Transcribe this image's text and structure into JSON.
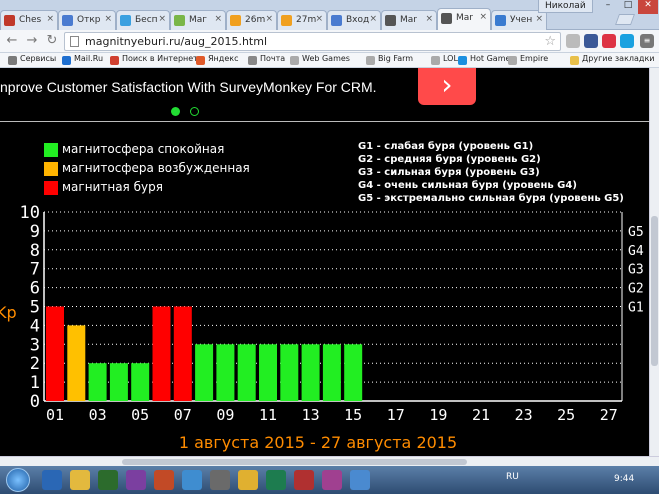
{
  "browser": {
    "tabs": [
      {
        "label": "Ches",
        "color": "#c0392b"
      },
      {
        "label": "Откр",
        "color": "#4a7bd0"
      },
      {
        "label": "Бесп",
        "color": "#3aa0e0"
      },
      {
        "label": "Maг",
        "color": "#7ab648"
      },
      {
        "label": "26m",
        "color": "#f0a020"
      },
      {
        "label": "27m",
        "color": "#f0a020"
      },
      {
        "label": "Вход",
        "color": "#4a7bd0"
      },
      {
        "label": "Mar",
        "color": "#555555"
      },
      {
        "label": "Mar",
        "color": "#555555"
      },
      {
        "label": "Учен",
        "color": "#3a7bd0"
      }
    ],
    "user_label": "Николай",
    "url": "magnitnyeburi.ru/aug_2015.html",
    "bookmarks": [
      {
        "label": "Сервисы",
        "color": "#7a7a7a"
      },
      {
        "label": "Mail.Ru",
        "color": "#1e6fd0"
      },
      {
        "label": "Поиск в Интернете",
        "color": "#d04030"
      },
      {
        "label": "Яндекс",
        "color": "#e05a2a"
      },
      {
        "label": "Почта",
        "color": "#888888"
      },
      {
        "label": "Web Games",
        "color": "#aaaaaa"
      },
      {
        "label": "Big Farm",
        "color": "#aaaaaa"
      },
      {
        "label": "LOL",
        "color": "#aaaaaa"
      },
      {
        "label": "Hot Game",
        "color": "#1a8fe0"
      },
      {
        "label": "Empire",
        "color": "#aaaaaa"
      },
      {
        "label": "Другие закладки",
        "color": "#e8c04a"
      }
    ]
  },
  "ad": {
    "text": "nprove Customer Satisfaction With SurveyMonkey For CRM.",
    "arrow": "›"
  },
  "legend": [
    {
      "label": "магнитосфера спокойная",
      "color": "#22ee22"
    },
    {
      "label": "магнитосфера возбужденная",
      "color": "#ffb400"
    },
    {
      "label": "магнитная буря",
      "color": "#ff0000"
    }
  ],
  "g_levels": [
    "G1 - слабая буря (уровень G1)",
    "G2 - средняя буря (уровень G2)",
    "G3 - сильная буря (уровень G3)",
    "G4 - очень сильная буря (уровень G4)",
    "G5 - экстремально сильная буря (уровень G5)"
  ],
  "chart_data": {
    "type": "bar",
    "ylabel": "Kp",
    "ylim": [
      0,
      10
    ],
    "y_ticks": [
      "0",
      "1",
      "2",
      "3",
      "4",
      "5",
      "6",
      "7",
      "8",
      "9",
      "10"
    ],
    "right_labels": [
      {
        "y": 5,
        "label": "G1"
      },
      {
        "y": 6,
        "label": "G2"
      },
      {
        "y": 7,
        "label": "G3"
      },
      {
        "y": 8,
        "label": "G4"
      },
      {
        "y": 9,
        "label": "G5"
      }
    ],
    "x_tick_labels": [
      "01",
      "03",
      "05",
      "07",
      "09",
      "11",
      "13",
      "15",
      "17",
      "19",
      "21",
      "23",
      "25",
      "27"
    ],
    "title": "1 августа 2015 - 27 августа 2015",
    "values": [
      5,
      4,
      2,
      2,
      2,
      5,
      5,
      3,
      3,
      3,
      3,
      3,
      3,
      3,
      3
    ],
    "colors": [
      "#ff0000",
      "#ffc000",
      "#22ee22",
      "#22ee22",
      "#22ee22",
      "#ff0000",
      "#ff0000",
      "#22ee22",
      "#22ee22",
      "#22ee22",
      "#22ee22",
      "#22ee22",
      "#22ee22",
      "#22ee22",
      "#22ee22"
    ],
    "grid": true
  },
  "taskbar": {
    "lang": "RU",
    "time": "9:44"
  }
}
